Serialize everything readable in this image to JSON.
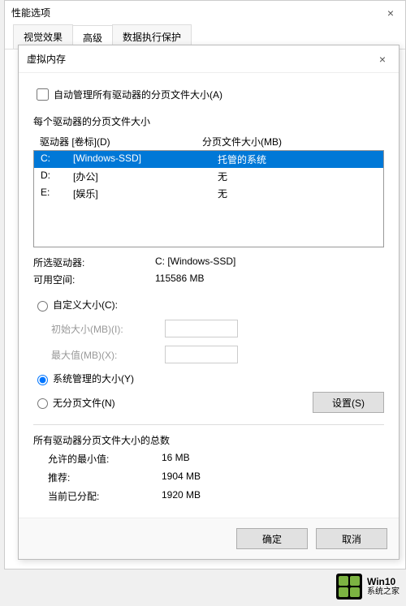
{
  "parent": {
    "title": "性能选项",
    "tabs": [
      "视觉效果",
      "高级",
      "数据执行保护"
    ]
  },
  "vm": {
    "title": "虚拟内存",
    "auto_manage": "自动管理所有驱动器的分页文件大小(A)",
    "each_drive_label": "每个驱动器的分页文件大小",
    "col_drive": "驱动器 [卷标](D)",
    "col_size": "分页文件大小(MB)",
    "drives": [
      {
        "letter": "C:",
        "label": "[Windows-SSD]",
        "size": "托管的系统"
      },
      {
        "letter": "D:",
        "label": "[办公]",
        "size": "无"
      },
      {
        "letter": "E:",
        "label": "[娱乐]",
        "size": "无"
      }
    ],
    "selected_drive_label": "所选驱动器:",
    "selected_drive_value": "C:  [Windows-SSD]",
    "free_space_label": "可用空间:",
    "free_space_value": "115586 MB",
    "custom_size": "自定义大小(C):",
    "initial_size": "初始大小(MB)(I):",
    "max_size": "最大值(MB)(X):",
    "system_managed": "系统管理的大小(Y)",
    "no_paging": "无分页文件(N)",
    "set_button": "设置(S)",
    "totals_label": "所有驱动器分页文件大小的总数",
    "min_allowed_label": "允许的最小值:",
    "min_allowed_value": "16 MB",
    "recommended_label": "推荐:",
    "recommended_value": "1904 MB",
    "current_label": "当前已分配:",
    "current_value": "1920 MB",
    "ok": "确定",
    "cancel": "取消"
  },
  "watermark": {
    "title": "Win10",
    "subtitle": "系统之家"
  }
}
